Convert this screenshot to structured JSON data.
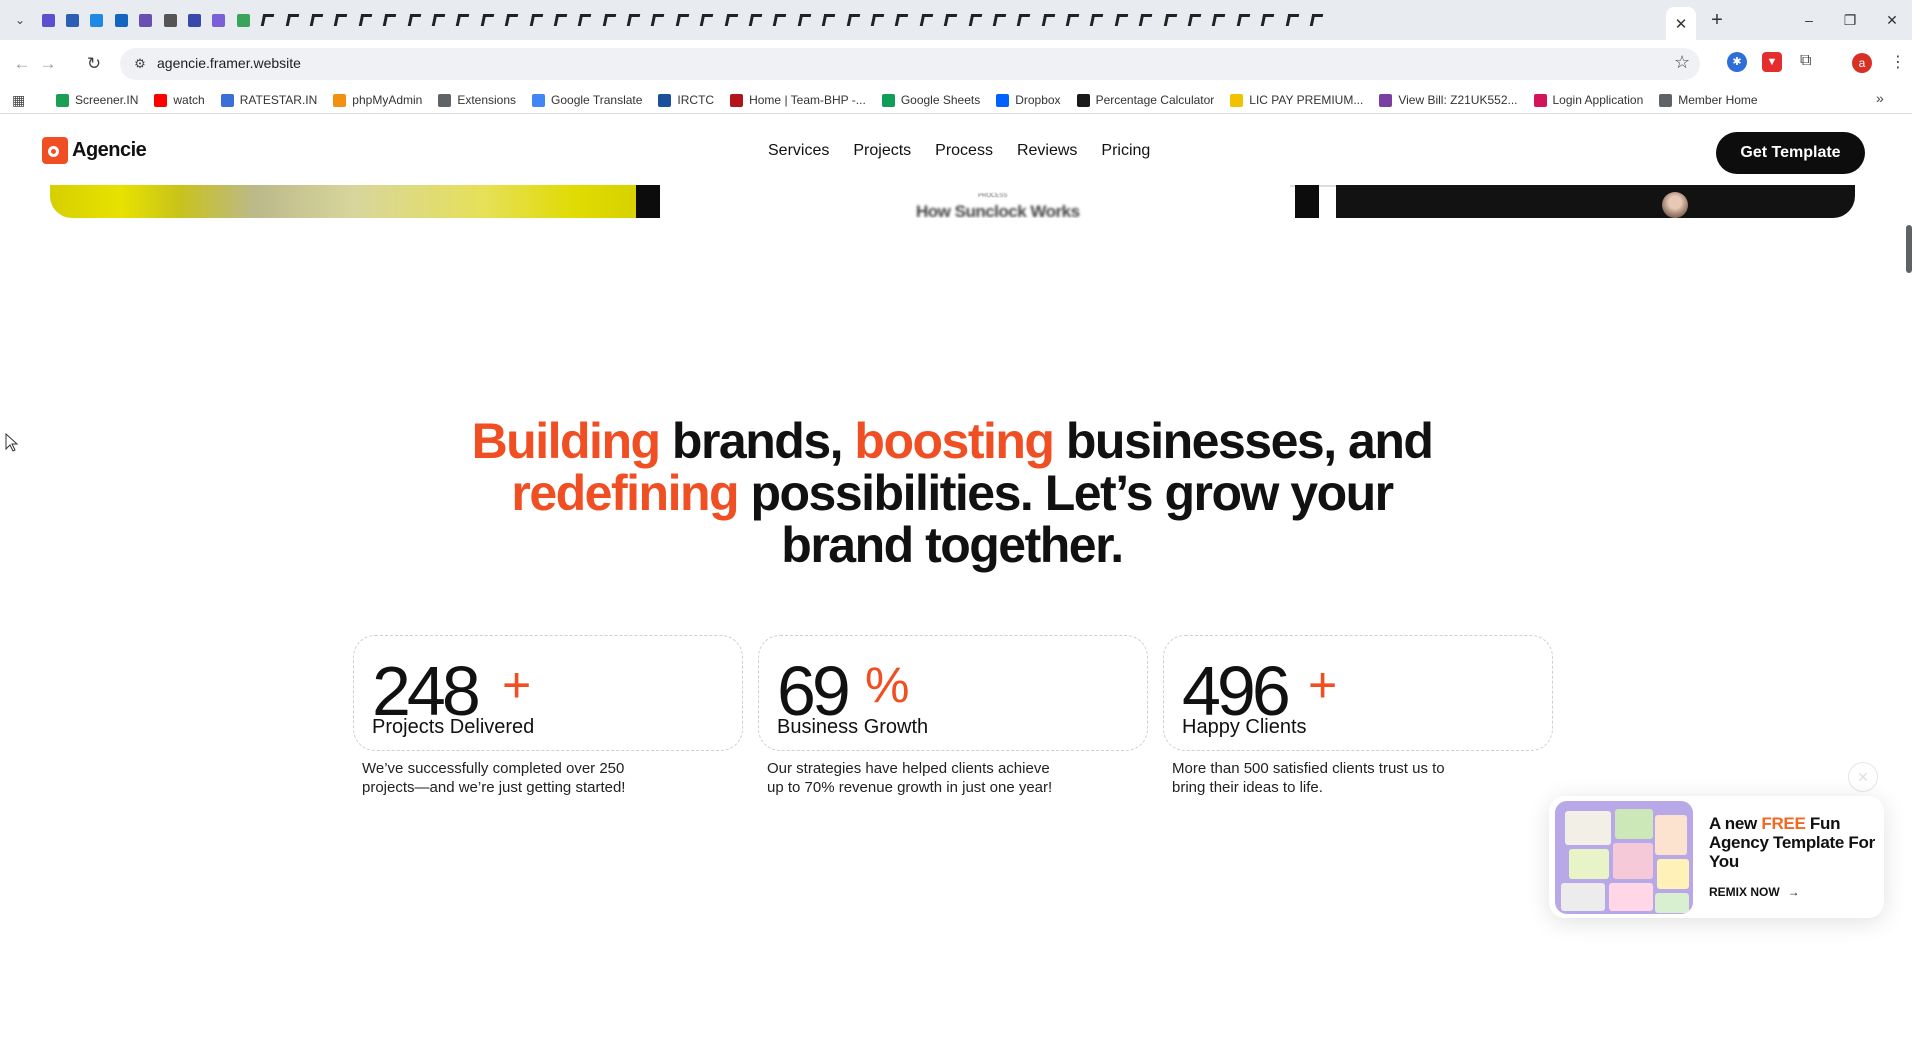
{
  "browser": {
    "url": "agencie.framer.website",
    "active_tab_close": "✕",
    "new_tab": "+",
    "window_controls": {
      "minimize": "–",
      "maximize": "❐",
      "close": "✕"
    },
    "profile_initial": "a",
    "bookmarks": [
      {
        "label": "Screener.IN",
        "icon": "screener-icon",
        "color": "#1d9e55"
      },
      {
        "label": "watch",
        "icon": "youtube-icon",
        "color": "#ff0000"
      },
      {
        "label": "RATESTAR.IN",
        "icon": "ratestar-icon",
        "color": "#3a6fd8"
      },
      {
        "label": "phpMyAdmin",
        "icon": "phpmyadmin-icon",
        "color": "#f29111"
      },
      {
        "label": "Extensions",
        "icon": "puzzle-icon",
        "color": "#5f6368"
      },
      {
        "label": "Google Translate",
        "icon": "translate-icon",
        "color": "#4285f4"
      },
      {
        "label": "IRCTC",
        "icon": "irctc-icon",
        "color": "#1a4f9c"
      },
      {
        "label": "Home | Team-BHP -...",
        "icon": "teambhp-icon",
        "color": "#b3141c"
      },
      {
        "label": "Google Sheets",
        "icon": "sheets-icon",
        "color": "#0f9d58"
      },
      {
        "label": "Dropbox",
        "icon": "dropbox-icon",
        "color": "#0061fe"
      },
      {
        "label": "Percentage Calculator",
        "icon": "percent-icon",
        "color": "#1a1a1a"
      },
      {
        "label": "LIC PAY PREMIUM...",
        "icon": "lic-icon",
        "color": "#f2c200"
      },
      {
        "label": "View Bill: Z21UK552...",
        "icon": "bill-icon",
        "color": "#7a3fa0"
      },
      {
        "label": "Login Application",
        "icon": "login-icon",
        "color": "#d4145a"
      },
      {
        "label": "Member Home",
        "icon": "globe-icon",
        "color": "#5f6368"
      }
    ]
  },
  "site": {
    "brand": "Agencie",
    "nav": [
      "Services",
      "Projects",
      "Process",
      "Reviews",
      "Pricing"
    ],
    "cta": "Get Template",
    "strip_text": "How Sunclock Works",
    "strip_small": "PROCESS"
  },
  "headline": {
    "parts": [
      {
        "text": "Building",
        "accent": true
      },
      {
        "text": " brands, ",
        "accent": false
      },
      {
        "text": "boosting",
        "accent": true
      },
      {
        "text": " businesses, and ",
        "accent": false
      },
      {
        "text": "redefining",
        "accent": true
      },
      {
        "text": " possibilities. Let’s grow your brand together.",
        "accent": false
      }
    ],
    "accent_color": "#f04e23"
  },
  "stats": [
    {
      "number": "248",
      "suffix": "+",
      "label": "Projects Delivered",
      "description": "We’ve successfully completed over 250 projects—and we’re just getting started!"
    },
    {
      "number": "69",
      "suffix": "%",
      "label": "Business Growth",
      "description": "Our strategies have helped clients achieve up to 70% revenue growth in just one year!"
    },
    {
      "number": "496",
      "suffix": "+",
      "label": "Happy Clients",
      "description": "More than 500 satisfied clients trust us to bring their ideas to life."
    }
  ],
  "promo": {
    "title_prefix": "A new ",
    "title_highlight": "FREE",
    "title_rest": " Fun Agency Template For You",
    "cta": "REMIX NOW",
    "close": "✕"
  }
}
